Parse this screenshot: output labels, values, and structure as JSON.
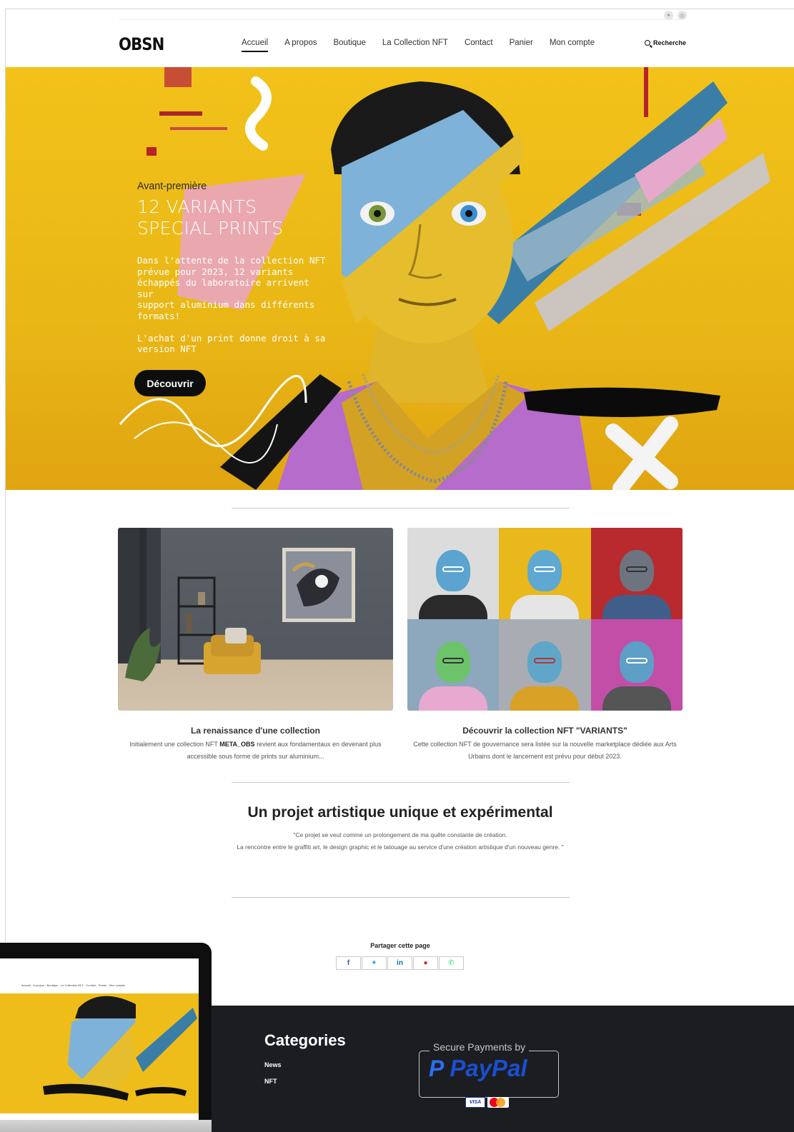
{
  "header": {
    "logo": "OBSN",
    "nav": [
      "Accueil",
      "A propos",
      "Boutique",
      "La Collection NFT",
      "Contact",
      "Panier",
      "Mon compte"
    ],
    "active_nav": "Accueil",
    "search_label": "Recherche"
  },
  "hero": {
    "eyebrow": "Avant-première",
    "title": "12 VARIANTS\nSPECIAL PRINTS",
    "description": "Dans l'attente de la collection NFT\nprévue pour 2023, 12 variants\néchappés du laboratoire arrivent sur\nsupport aluminium dans différents\nformats!\n\nL'achat d'un print donne droit à sa\nversion NFT",
    "button_label": "Découvrir"
  },
  "cards": [
    {
      "title": "La renaissance d'une collection",
      "text_before": "Initialement une collection NFT ",
      "text_bold": "META_OBS",
      "text_after": " revient aux fondamentaux en devenant plus accessible sous forme de prints sur aluminium..."
    },
    {
      "title": "Découvrir la collection NFT  \"VARIANTS\"",
      "text": "Cette collection NFT de gouvernance sera listée sur la nouvelle marketplace dédiée aux Arts Urbains dont le lancement est prévu pour début 2023."
    }
  ],
  "project": {
    "title": "Un projet artistique unique et expérimental",
    "quote_line1": "\"Ce projet se veut comme un prolongement de ma quête constante de création.",
    "quote_line2": "La rencontre entre le graffiti art, le design graphic et le tatouage au service d'une création artistique d'un nouveau genre. \""
  },
  "share": {
    "title": "Partager cette page",
    "buttons": [
      {
        "icon": "facebook-icon",
        "glyph": "f",
        "color": "#3b5998"
      },
      {
        "icon": "twitter-icon",
        "glyph": "✦",
        "color": "#1da1f2"
      },
      {
        "icon": "linkedin-icon",
        "glyph": "in",
        "color": "#0077b5"
      },
      {
        "icon": "pinterest-icon",
        "glyph": "℗",
        "color": "#cb2027"
      },
      {
        "icon": "whatsapp-icon",
        "glyph": "✆",
        "color": "#25d366"
      }
    ]
  },
  "footer": {
    "categories_title": "Categories",
    "categories": [
      "News",
      "NFT"
    ],
    "payment_caption": "Secure Payments by",
    "payment_brand": "PayPal",
    "payment_cards": [
      "VISA",
      "MasterCard"
    ]
  },
  "colors": {
    "hero_yellow": "#f2c21a",
    "button_black": "#0d0d0d",
    "footer_bg": "#1c1d21",
    "paypal_blue": "#1a4fd1"
  }
}
